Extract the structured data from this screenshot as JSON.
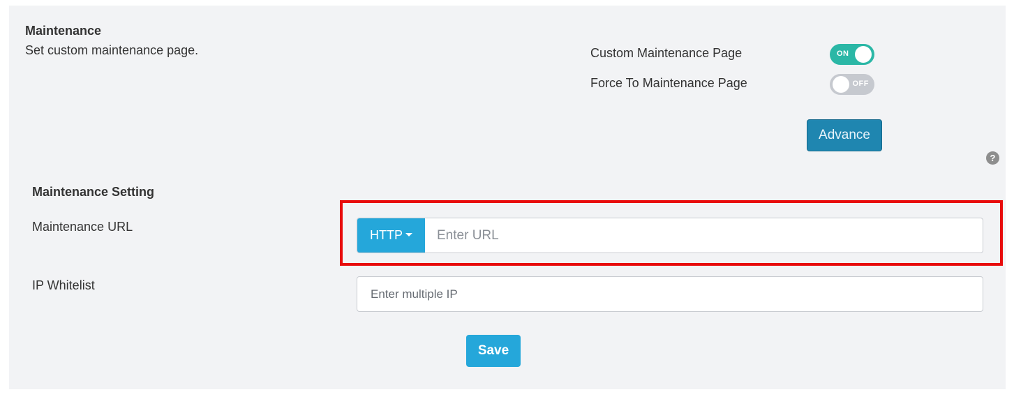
{
  "maintenance": {
    "title": "Maintenance",
    "description": "Set custom maintenance page.",
    "toggles": [
      {
        "label": "Custom Maintenance Page",
        "state": "ON",
        "enabled": true,
        "color": "#2bb7a6"
      },
      {
        "label": "Force To Maintenance Page",
        "state": "OFF",
        "enabled": false,
        "color": "#c6c9cf"
      }
    ],
    "advance_label": "Advance",
    "help_icon": "?"
  },
  "settings": {
    "title": "Maintenance Setting",
    "url": {
      "label": "Maintenance URL",
      "protocol": "HTTP",
      "placeholder": "Enter URL",
      "value": ""
    },
    "ip_whitelist": {
      "label": "IP Whitelist",
      "placeholder": "Enter multiple IP",
      "value": ""
    },
    "save_label": "Save"
  },
  "colors": {
    "accent": "#25a7da",
    "advance": "#1f86b0",
    "highlight": "#e80b0b",
    "panel_bg": "#f2f3f5"
  },
  "icons": {
    "help": "help-icon",
    "dropdown": "caret-down-icon"
  }
}
